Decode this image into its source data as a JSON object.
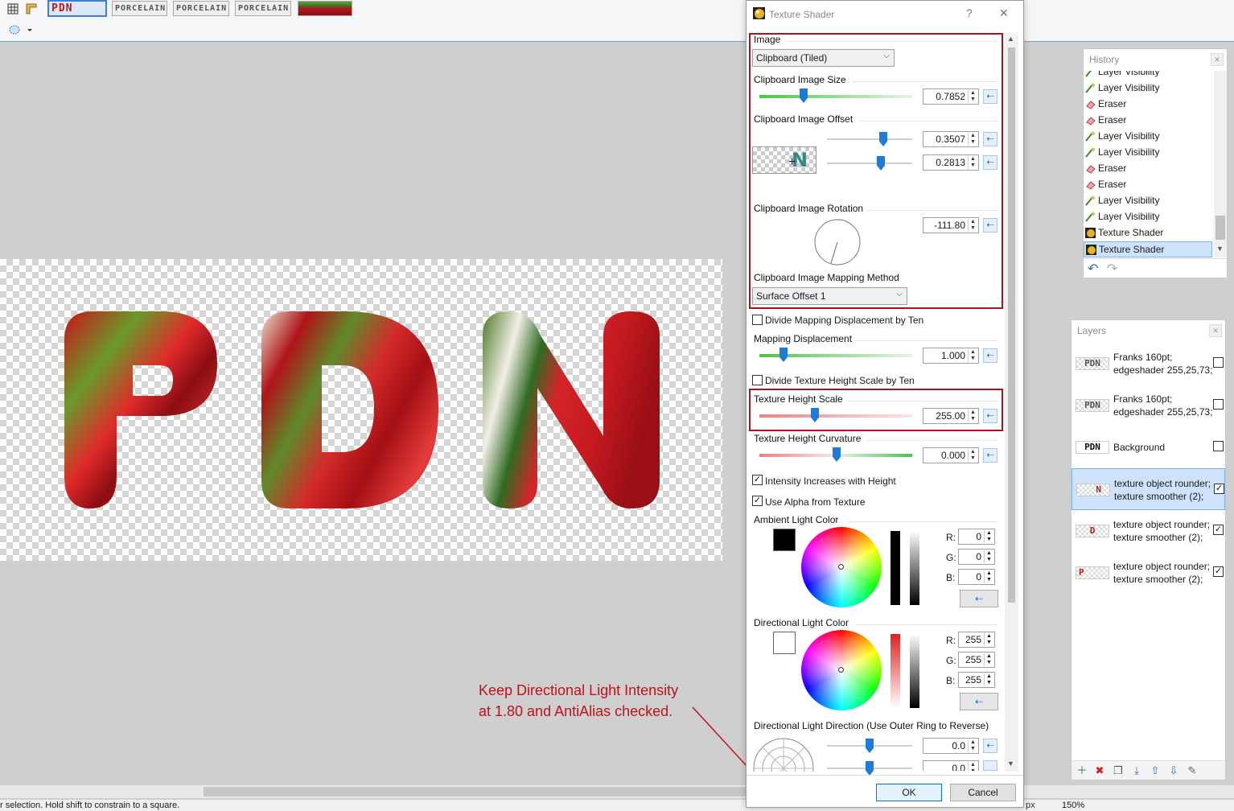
{
  "toolbar": {
    "thumbnails": [
      "PDN",
      "PORCELAIN",
      "PORCELAIN",
      "PORCELAIN",
      ""
    ]
  },
  "statusbar": {
    "hint": "r selection. Hold shift to constrain to a square.",
    "unit": "px",
    "zoom": "150%"
  },
  "dialog": {
    "title": "Texture Shader",
    "help": "?",
    "close": "✕",
    "image_label": "Image",
    "image_value": "Clipboard (Tiled)",
    "size_label": "Clipboard Image Size",
    "size_value": "0.7852",
    "size_fraction": 0.28,
    "offset_label": "Clipboard Image Offset",
    "offset_x": "0.3507",
    "offset_y": "0.2813",
    "rotation_label": "Clipboard Image Rotation",
    "rotation_value": "-111.80",
    "mapping_label": "Clipboard Image Mapping Method",
    "mapping_value": "Surface Offset 1",
    "divide_mapping_label": "Divide Mapping Displacement by Ten",
    "divide_mapping_checked": false,
    "displacement_label": "Mapping Displacement",
    "displacement_value": "1.000",
    "divide_height_label": "Divide Texture Height Scale by Ten",
    "divide_height_checked": false,
    "height_scale_label": "Texture Height Scale",
    "height_scale_value": "255.00",
    "curvature_label": "Texture Height Curvature",
    "curvature_value": "0.000",
    "intensity_label": "Intensity Increases with Height",
    "intensity_checked": true,
    "alpha_label": "Use Alpha from Texture",
    "alpha_checked": true,
    "ambient_label": "Ambient Light Color",
    "ambient": {
      "r": "0",
      "g": "0",
      "b": "0",
      "color": "#000000"
    },
    "directional_label": "Directional Light Color",
    "directional": {
      "r": "255",
      "g": "255",
      "b": "255",
      "color": "#ffffff"
    },
    "r_label": "R:",
    "g_label": "G:",
    "b_label": "B:",
    "direction_label": "Directional Light Direction (Use Outer Ring to Reverse)",
    "direction_value_1": "0.0",
    "direction_value_2": "0.0",
    "ok": "OK",
    "cancel": "Cancel"
  },
  "history": {
    "title": "History",
    "items": [
      {
        "label": "Layer Visibility",
        "icon": "visibility-icon"
      },
      {
        "label": "Layer Visibility",
        "icon": "visibility-icon"
      },
      {
        "label": "Eraser",
        "icon": "eraser-icon"
      },
      {
        "label": "Eraser",
        "icon": "eraser-icon"
      },
      {
        "label": "Layer Visibility",
        "icon": "visibility-icon"
      },
      {
        "label": "Layer Visibility",
        "icon": "visibility-icon"
      },
      {
        "label": "Eraser",
        "icon": "eraser-icon"
      },
      {
        "label": "Eraser",
        "icon": "eraser-icon"
      },
      {
        "label": "Layer Visibility",
        "icon": "visibility-icon"
      },
      {
        "label": "Layer Visibility",
        "icon": "visibility-icon"
      },
      {
        "label": "Texture Shader",
        "icon": "texture-shader-icon"
      },
      {
        "label": "Texture Shader",
        "icon": "texture-shader-icon"
      }
    ]
  },
  "layers": {
    "title": "Layers",
    "items": [
      {
        "line1": "Franks 160pt;",
        "line2": "edgeshader 255,25,73;",
        "thumb": "PDN",
        "visible": false
      },
      {
        "line1": "Franks 160pt;",
        "line2": "edgeshader 255,25,73;",
        "thumb": "PDN",
        "visible": false
      },
      {
        "line1": "Background",
        "line2": "",
        "thumb": "PDN",
        "visible": false
      },
      {
        "line1": "texture object rounder;",
        "line2": "texture smoother (2);",
        "thumb": "N",
        "visible": true
      },
      {
        "line1": "texture object rounder;",
        "line2": "texture smoother (2);",
        "thumb": "D",
        "visible": true
      },
      {
        "line1": "texture object rounder;",
        "line2": "texture smoother (2);",
        "thumb": "P",
        "visible": true
      }
    ]
  },
  "canvas": {
    "letters": [
      "P",
      "D",
      "N"
    ]
  },
  "annotation": {
    "line1": "Keep Directional Light Intensity",
    "line2": "at 1.80 and AntiAlias checked."
  },
  "colors": {
    "accent": "#1e7bd6",
    "highlight_box": "#b0121b",
    "annotation": "#c0121a"
  }
}
